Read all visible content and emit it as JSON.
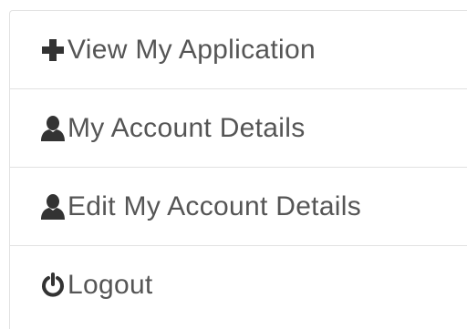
{
  "menu": {
    "items": [
      {
        "label": "View My Application",
        "icon": "plus-icon"
      },
      {
        "label": "My Account Details",
        "icon": "user-icon"
      },
      {
        "label": "Edit My Account Details",
        "icon": "user-icon"
      },
      {
        "label": "Logout",
        "icon": "power-icon"
      }
    ]
  },
  "colors": {
    "text": "#555555",
    "icon": "#333333",
    "border": "#e2e2e2",
    "background": "#ffffff"
  }
}
